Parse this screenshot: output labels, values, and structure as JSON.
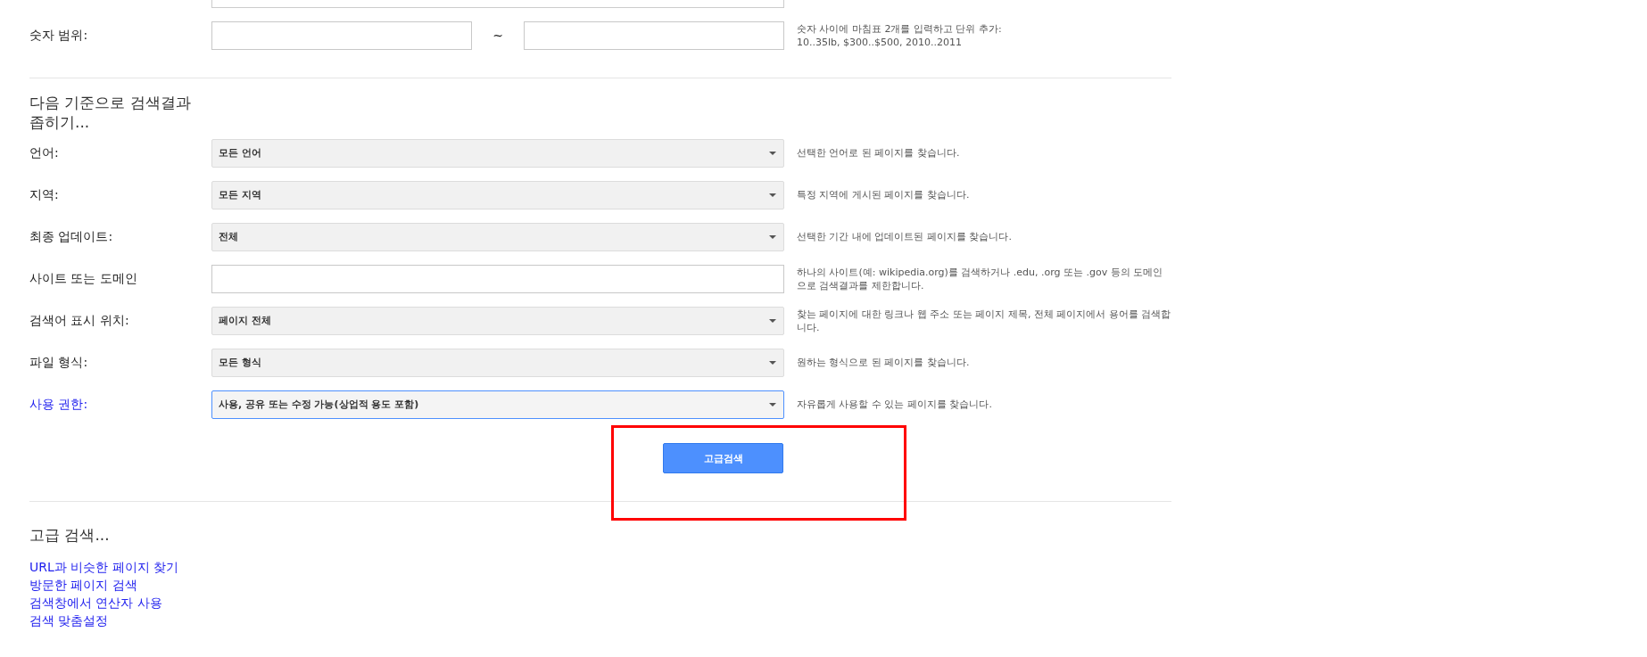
{
  "number_range": {
    "label": "숫자 범위:",
    "separator": "~",
    "help": [
      "숫자 사이에 마침표 2개를 입력하고 단위 추가:",
      "10..35lb, $300..$500, 2010..2011"
    ]
  },
  "narrow_heading": "다음 기준으로 검색결과 좁히기...",
  "filters": [
    {
      "kind": "select",
      "label": "언어:",
      "value": "모든 언어",
      "help": "선택한 언어로 된 페이지를 찾습니다.",
      "focused": false
    },
    {
      "kind": "select",
      "label": "지역:",
      "value": "모든 지역",
      "help": "특정 지역에 게시된 페이지를 찾습니다.",
      "focused": false
    },
    {
      "kind": "select",
      "label": "최종 업데이트:",
      "value": "전체",
      "help": "선택한 기간 내에 업데이트된 페이지를 찾습니다.",
      "focused": false
    },
    {
      "kind": "text",
      "label": "사이트 또는 도메인",
      "help": "하나의 사이트(예: wikipedia.org)를 검색하거나 .edu, .org 또는 .gov 등의 도메인으로 검색결과를 제한합니다.",
      "focused": false
    },
    {
      "kind": "select",
      "label": "검색어 표시 위치:",
      "value": "페이지 전체",
      "help": "찾는 페이지에 대한 링크나 웹 주소 또는 페이지 제목, 전체 페이지에서 용어를 검색합니다.",
      "focused": false
    },
    {
      "kind": "select",
      "label": "파일 형식:",
      "value": "모든 형식",
      "help": "원하는 형식으로 된 페이지를 찾습니다.",
      "focused": false
    },
    {
      "kind": "select",
      "label": "사용 권한:",
      "value": "사용, 공유 또는 수정 가능(상업적 용도 포함)",
      "help": "자유롭게 사용할 수 있는 페이지를 찾습니다.",
      "focused": true
    }
  ],
  "submit_button": "고급검색",
  "more_heading": "고급 검색...",
  "links": [
    "URL과 비슷한 페이지 찾기",
    "방문한 페이지 검색",
    "검색창에서 연산자 사용",
    "검색 맞춤설정"
  ]
}
